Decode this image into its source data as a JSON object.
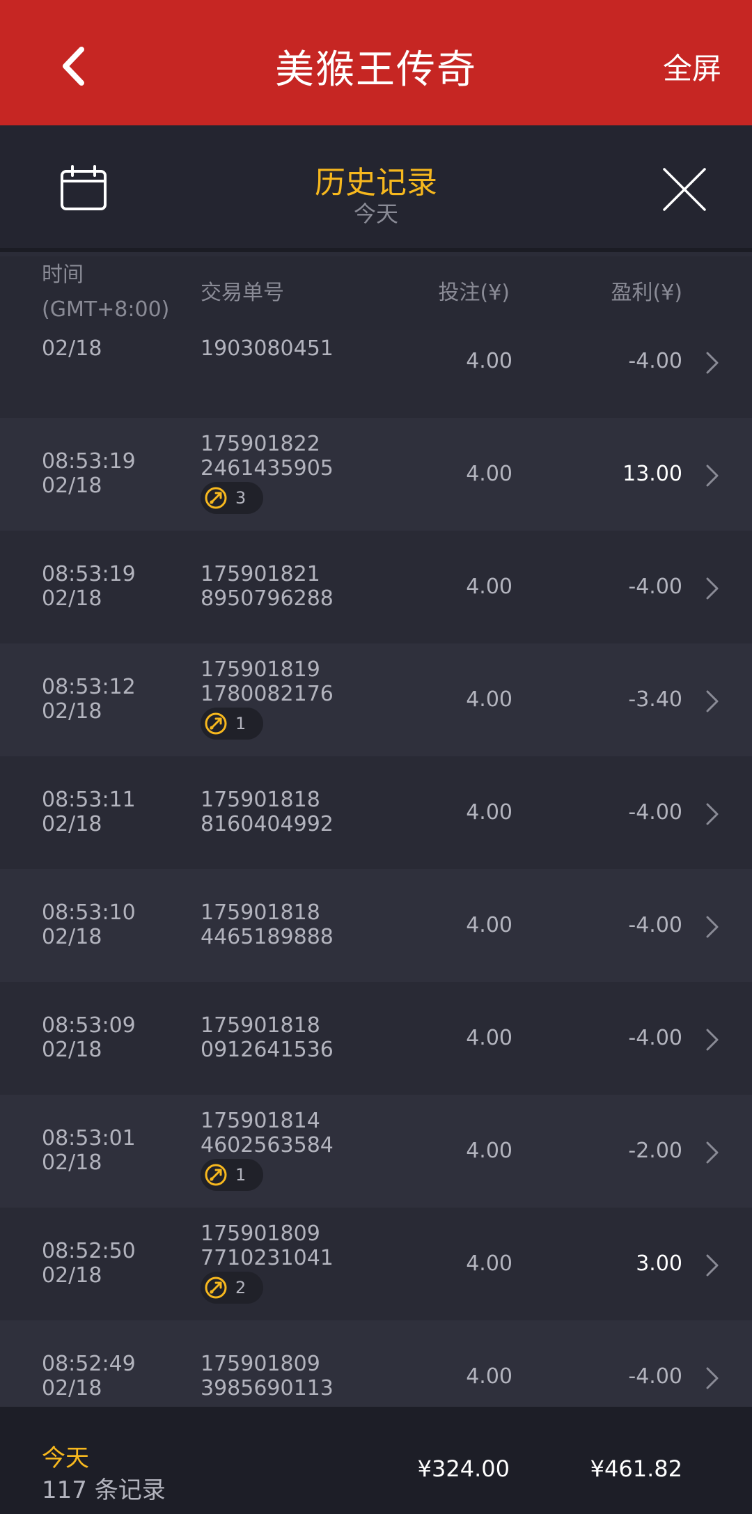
{
  "app": {
    "title": "美猴王传奇",
    "fullscreen_label": "全屏"
  },
  "history": {
    "title": "历史记录",
    "subtitle": "今天"
  },
  "columns": {
    "time_line1": "时间",
    "time_line2": "(GMT+8:00)",
    "tx": "交易单号",
    "bet": "投注(¥)",
    "profit": "盈利(¥)"
  },
  "rows": [
    {
      "time": "",
      "date": "02/18",
      "tx1": "",
      "tx2": "1903080451",
      "bet": "4.00",
      "profit": "-4.00",
      "badge": ""
    },
    {
      "time": "08:53:19",
      "date": "02/18",
      "tx1": "175901822",
      "tx2": "2461435905",
      "bet": "4.00",
      "profit": "13.00",
      "badge": "3"
    },
    {
      "time": "08:53:19",
      "date": "02/18",
      "tx1": "175901821",
      "tx2": "8950796288",
      "bet": "4.00",
      "profit": "-4.00",
      "badge": ""
    },
    {
      "time": "08:53:12",
      "date": "02/18",
      "tx1": "175901819",
      "tx2": "1780082176",
      "bet": "4.00",
      "profit": "-3.40",
      "badge": "1"
    },
    {
      "time": "08:53:11",
      "date": "02/18",
      "tx1": "175901818",
      "tx2": "8160404992",
      "bet": "4.00",
      "profit": "-4.00",
      "badge": ""
    },
    {
      "time": "08:53:10",
      "date": "02/18",
      "tx1": "175901818",
      "tx2": "4465189888",
      "bet": "4.00",
      "profit": "-4.00",
      "badge": ""
    },
    {
      "time": "08:53:09",
      "date": "02/18",
      "tx1": "175901818",
      "tx2": "0912641536",
      "bet": "4.00",
      "profit": "-4.00",
      "badge": ""
    },
    {
      "time": "08:53:01",
      "date": "02/18",
      "tx1": "175901814",
      "tx2": "4602563584",
      "bet": "4.00",
      "profit": "-2.00",
      "badge": "1"
    },
    {
      "time": "08:52:50",
      "date": "02/18",
      "tx1": "175901809",
      "tx2": "7710231041",
      "bet": "4.00",
      "profit": "3.00",
      "badge": "2"
    },
    {
      "time": "08:52:49",
      "date": "02/18",
      "tx1": "175901809",
      "tx2": "3985690113",
      "bet": "4.00",
      "profit": "-4.00",
      "badge": ""
    }
  ],
  "footer": {
    "period": "今天",
    "count": "117 条记录",
    "total_bet": "¥324.00",
    "total_profit": "¥461.82"
  },
  "colors": {
    "header_red": "#c62623",
    "accent_yellow": "#f7b81e",
    "row_a": "#2f303c",
    "row_b": "#292a35"
  },
  "icons": [
    "back-arrow-icon",
    "calendar-icon",
    "close-icon",
    "chevron-right-icon",
    "free-spin-icon"
  ]
}
